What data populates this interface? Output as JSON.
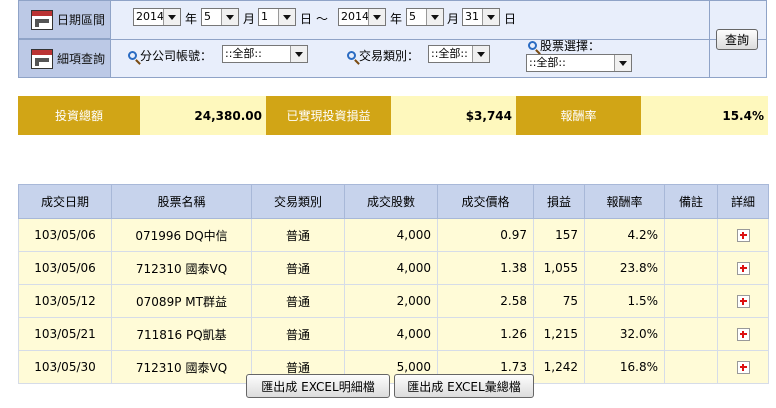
{
  "filter": {
    "date_range_label": "日期區間",
    "detail_query_label": "細項查詢",
    "start_year": "2014",
    "start_month": "5",
    "start_day": "1",
    "end_year": "2014",
    "end_month": "5",
    "end_day": "31",
    "year_unit": "年",
    "month_unit": "月",
    "day_unit": "日",
    "range_sep": "～",
    "branch_account_label": "分公司帳號：",
    "branch_account_value": "::全部::",
    "trade_type_label": "交易類別：",
    "trade_type_value": "::全部::",
    "stock_select_label": "股票選擇：",
    "stock_select_value": "::全部::",
    "query_button": "查詢"
  },
  "summary": {
    "total_invest_label": "投資總額",
    "total_invest_value": "24,380.00",
    "realized_label": "已實現投資損益",
    "realized_value": "$3,744",
    "return_label": "報酬率",
    "return_value": "15.4%"
  },
  "table": {
    "headers": [
      "成交日期",
      "股票名稱",
      "交易類別",
      "成交股數",
      "成交價格",
      "損益",
      "報酬率",
      "備註",
      "詳細"
    ],
    "rows": [
      {
        "date": "103/05/06",
        "stock": "071996 DQ中信",
        "type": "普通",
        "shares": "4,000",
        "price": "0.97",
        "pl": "157",
        "ret": "4.2%",
        "note": ""
      },
      {
        "date": "103/05/06",
        "stock": "712310 國泰VQ",
        "type": "普通",
        "shares": "4,000",
        "price": "1.38",
        "pl": "1,055",
        "ret": "23.8%",
        "note": ""
      },
      {
        "date": "103/05/12",
        "stock": "07089P MT群益",
        "type": "普通",
        "shares": "2,000",
        "price": "2.58",
        "pl": "75",
        "ret": "1.5%",
        "note": ""
      },
      {
        "date": "103/05/21",
        "stock": "711816 PQ凱基",
        "type": "普通",
        "shares": "4,000",
        "price": "1.26",
        "pl": "1,215",
        "ret": "32.0%",
        "note": ""
      },
      {
        "date": "103/05/30",
        "stock": "712310 國泰VQ",
        "type": "普通",
        "shares": "5,000",
        "price": "1.73",
        "pl": "1,242",
        "ret": "16.8%",
        "note": ""
      }
    ]
  },
  "export": {
    "detail_button": "匯出成 EXCEL明細檔",
    "summary_button": "匯出成 EXCEL彙總檔"
  }
}
